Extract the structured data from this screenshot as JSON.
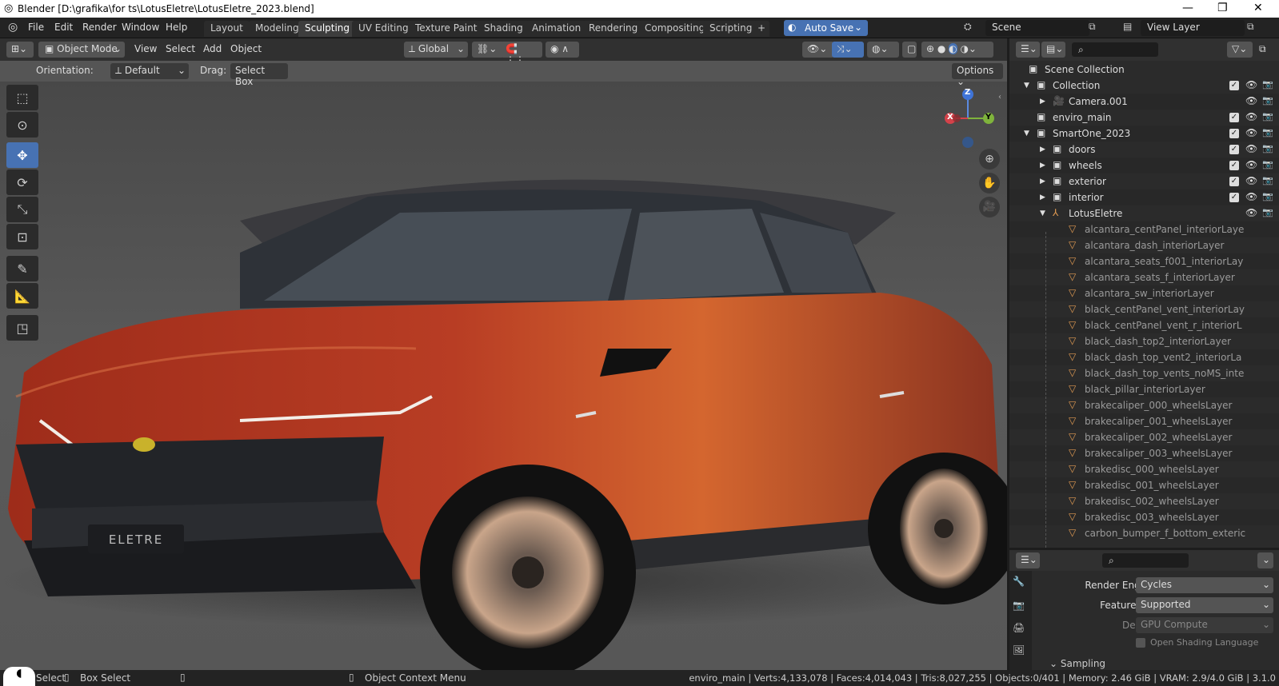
{
  "window": {
    "title": "Blender [D:\\grafika\\for ts\\LotusEletre\\LotusEletre_2023.blend]",
    "controls": [
      "—",
      "❐",
      "✕"
    ]
  },
  "menu": [
    "File",
    "Edit",
    "Render",
    "Window",
    "Help"
  ],
  "workspaces": [
    "Layout",
    "Modeling",
    "Sculpting",
    "UV Editing",
    "Texture Paint",
    "Shading",
    "Animation",
    "Rendering",
    "Compositing",
    "Scripting"
  ],
  "active_workspace": "Sculpting",
  "autosave": "Auto Save",
  "scene": {
    "name": "Scene",
    "view_layer": "View Layer"
  },
  "viewport_header": {
    "mode": "Object Mode",
    "menus": [
      "View",
      "Select",
      "Add",
      "Object"
    ],
    "transform": "Global"
  },
  "tool_settings": {
    "orientation_label": "Orientation:",
    "orientation": "Default",
    "drag_label": "Drag:",
    "drag": "Select Box",
    "options": "Options"
  },
  "gizmo": {
    "x": "X",
    "y": "Y",
    "z": "Z"
  },
  "car": {
    "plate": "ELETRE"
  },
  "outliner": {
    "root": "Scene Collection",
    "rows": [
      {
        "label": "Collection",
        "indent": 1,
        "expand": "▼",
        "type": "collection",
        "chk": true
      },
      {
        "label": "Camera.001",
        "indent": 2,
        "expand": "▶",
        "type": "camera",
        "chk": false
      },
      {
        "label": "enviro_main",
        "indent": 1,
        "expand": "",
        "type": "collection",
        "chk": true
      },
      {
        "label": "SmartOne_2023",
        "indent": 1,
        "expand": "▼",
        "type": "collection",
        "chk": true
      },
      {
        "label": "doors",
        "indent": 2,
        "expand": "▶",
        "type": "collection",
        "chk": true
      },
      {
        "label": "wheels",
        "indent": 2,
        "expand": "▶",
        "type": "collection",
        "chk": true
      },
      {
        "label": "exterior",
        "indent": 2,
        "expand": "▶",
        "type": "collection",
        "chk": true
      },
      {
        "label": "interior",
        "indent": 2,
        "expand": "▶",
        "type": "collection",
        "chk": true
      },
      {
        "label": "LotusEletre",
        "indent": 2,
        "expand": "▼",
        "type": "empty",
        "chk": false
      },
      {
        "label": "alcantara_centPanel_interiorLaye",
        "indent": 3,
        "type": "mesh"
      },
      {
        "label": "alcantara_dash_interiorLayer",
        "indent": 3,
        "type": "mesh"
      },
      {
        "label": "alcantara_seats_f001_interiorLay",
        "indent": 3,
        "type": "mesh"
      },
      {
        "label": "alcantara_seats_f_interiorLayer",
        "indent": 3,
        "type": "mesh"
      },
      {
        "label": "alcantara_sw_interiorLayer",
        "indent": 3,
        "type": "mesh"
      },
      {
        "label": "black_centPanel_vent_interiorLay",
        "indent": 3,
        "type": "mesh"
      },
      {
        "label": "black_centPanel_vent_r_interiorL",
        "indent": 3,
        "type": "mesh"
      },
      {
        "label": "black_dash_top2_interiorLayer",
        "indent": 3,
        "type": "mesh"
      },
      {
        "label": "black_dash_top_vent2_interiorLa",
        "indent": 3,
        "type": "mesh"
      },
      {
        "label": "black_dash_top_vents_noMS_inte",
        "indent": 3,
        "type": "mesh"
      },
      {
        "label": "black_pillar_interiorLayer",
        "indent": 3,
        "type": "mesh"
      },
      {
        "label": "brakecaliper_000_wheelsLayer",
        "indent": 3,
        "type": "mesh"
      },
      {
        "label": "brakecaliper_001_wheelsLayer",
        "indent": 3,
        "type": "mesh"
      },
      {
        "label": "brakecaliper_002_wheelsLayer",
        "indent": 3,
        "type": "mesh"
      },
      {
        "label": "brakecaliper_003_wheelsLayer",
        "indent": 3,
        "type": "mesh"
      },
      {
        "label": "brakedisc_000_wheelsLayer",
        "indent": 3,
        "type": "mesh"
      },
      {
        "label": "brakedisc_001_wheelsLayer",
        "indent": 3,
        "type": "mesh"
      },
      {
        "label": "brakedisc_002_wheelsLayer",
        "indent": 3,
        "type": "mesh"
      },
      {
        "label": "brakedisc_003_wheelsLayer",
        "indent": 3,
        "type": "mesh"
      },
      {
        "label": "carbon_bumper_f_bottom_exteric",
        "indent": 3,
        "type": "mesh"
      }
    ]
  },
  "properties": {
    "render_engine_label": "Render Engine",
    "render_engine": "Cycles",
    "feature_set_label": "Feature Set",
    "feature_set": "Supported",
    "device_label": "Device",
    "device": "GPU Compute",
    "osl_label": "Open Shading Language",
    "section": "Sampling"
  },
  "status": {
    "select": "Select",
    "box_select": "Box Select",
    "context_menu": "Object Context Menu",
    "stats": "enviro_main | Verts:4,133,078 | Faces:4,014,043 | Tris:8,027,255 | Objects:0/401 | Memory: 2.46 GiB | VRAM: 2.9/4.0 GiB | 3.1.0"
  },
  "colors": {
    "accent": "#4772b3",
    "car_paint": "#c4442a"
  }
}
